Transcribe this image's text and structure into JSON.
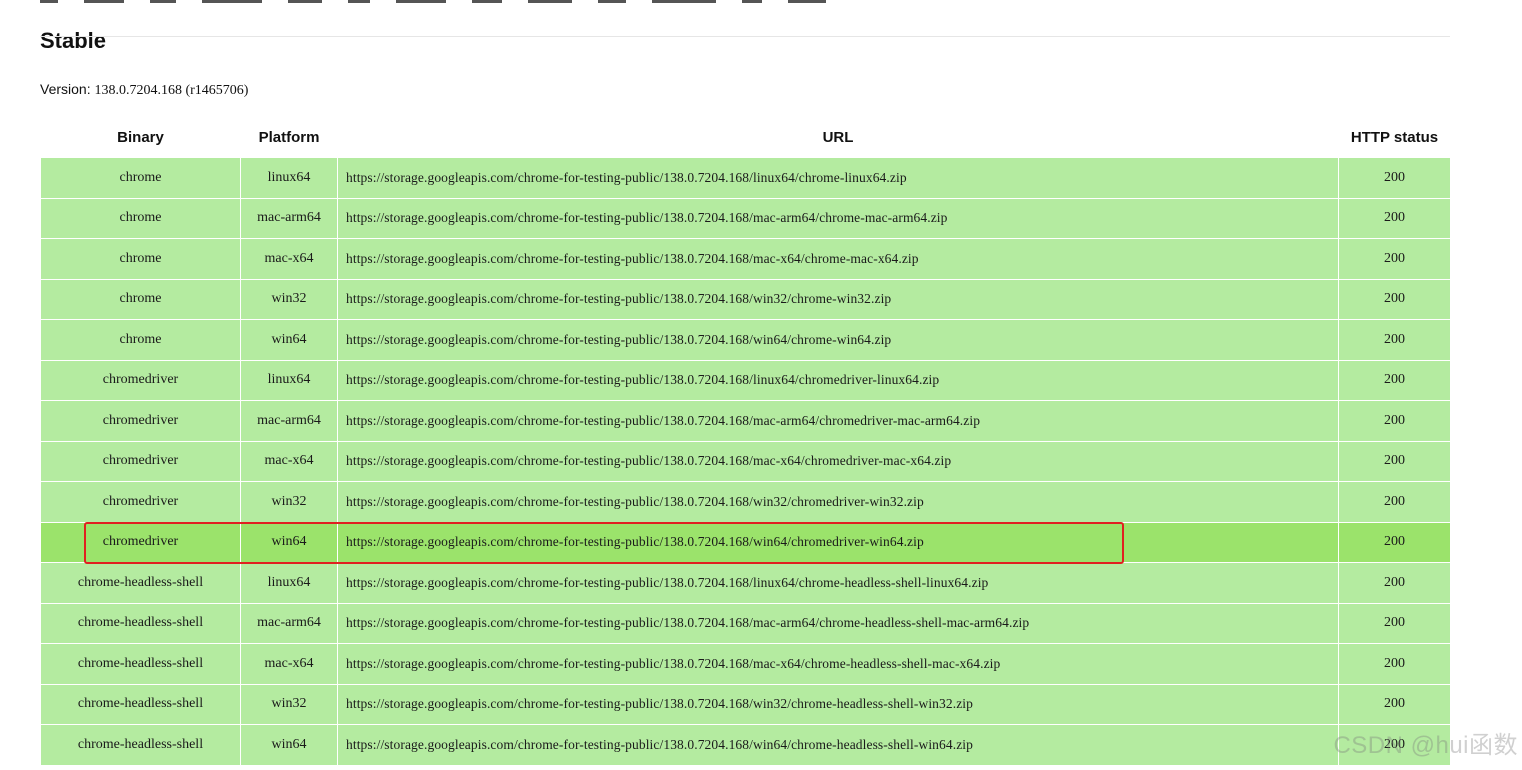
{
  "section": {
    "heading": "Stable",
    "version_label": "Version:",
    "version_value": "138.0.7204.168 (r1465706)"
  },
  "table": {
    "headers": [
      "Binary",
      "Platform",
      "URL",
      "HTTP status"
    ],
    "rows": [
      {
        "binary": "chrome",
        "platform": "linux64",
        "url": "https://storage.googleapis.com/chrome-for-testing-public/138.0.7204.168/linux64/chrome-linux64.zip",
        "status": "200"
      },
      {
        "binary": "chrome",
        "platform": "mac-arm64",
        "url": "https://storage.googleapis.com/chrome-for-testing-public/138.0.7204.168/mac-arm64/chrome-mac-arm64.zip",
        "status": "200"
      },
      {
        "binary": "chrome",
        "platform": "mac-x64",
        "url": "https://storage.googleapis.com/chrome-for-testing-public/138.0.7204.168/mac-x64/chrome-mac-x64.zip",
        "status": "200"
      },
      {
        "binary": "chrome",
        "platform": "win32",
        "url": "https://storage.googleapis.com/chrome-for-testing-public/138.0.7204.168/win32/chrome-win32.zip",
        "status": "200"
      },
      {
        "binary": "chrome",
        "platform": "win64",
        "url": "https://storage.googleapis.com/chrome-for-testing-public/138.0.7204.168/win64/chrome-win64.zip",
        "status": "200"
      },
      {
        "binary": "chromedriver",
        "platform": "linux64",
        "url": "https://storage.googleapis.com/chrome-for-testing-public/138.0.7204.168/linux64/chromedriver-linux64.zip",
        "status": "200"
      },
      {
        "binary": "chromedriver",
        "platform": "mac-arm64",
        "url": "https://storage.googleapis.com/chrome-for-testing-public/138.0.7204.168/mac-arm64/chromedriver-mac-arm64.zip",
        "status": "200"
      },
      {
        "binary": "chromedriver",
        "platform": "mac-x64",
        "url": "https://storage.googleapis.com/chrome-for-testing-public/138.0.7204.168/mac-x64/chromedriver-mac-x64.zip",
        "status": "200"
      },
      {
        "binary": "chromedriver",
        "platform": "win32",
        "url": "https://storage.googleapis.com/chrome-for-testing-public/138.0.7204.168/win32/chromedriver-win32.zip",
        "status": "200"
      },
      {
        "binary": "chromedriver",
        "platform": "win64",
        "url": "https://storage.googleapis.com/chrome-for-testing-public/138.0.7204.168/win64/chromedriver-win64.zip",
        "status": "200",
        "highlighted": true
      },
      {
        "binary": "chrome-headless-shell",
        "platform": "linux64",
        "url": "https://storage.googleapis.com/chrome-for-testing-public/138.0.7204.168/linux64/chrome-headless-shell-linux64.zip",
        "status": "200"
      },
      {
        "binary": "chrome-headless-shell",
        "platform": "mac-arm64",
        "url": "https://storage.googleapis.com/chrome-for-testing-public/138.0.7204.168/mac-arm64/chrome-headless-shell-mac-arm64.zip",
        "status": "200"
      },
      {
        "binary": "chrome-headless-shell",
        "platform": "mac-x64",
        "url": "https://storage.googleapis.com/chrome-for-testing-public/138.0.7204.168/mac-x64/chrome-headless-shell-mac-x64.zip",
        "status": "200"
      },
      {
        "binary": "chrome-headless-shell",
        "platform": "win32",
        "url": "https://storage.googleapis.com/chrome-for-testing-public/138.0.7204.168/win32/chrome-headless-shell-win32.zip",
        "status": "200"
      },
      {
        "binary": "chrome-headless-shell",
        "platform": "win64",
        "url": "https://storage.googleapis.com/chrome-for-testing-public/138.0.7204.168/win64/chrome-headless-shell-win64.zip",
        "status": "200"
      }
    ]
  },
  "watermark": "CSDN @hui函数",
  "colors": {
    "row_background": "#b4eba0",
    "highlighted_row_background": "#9be36b",
    "annotation_box": "#e02020"
  }
}
